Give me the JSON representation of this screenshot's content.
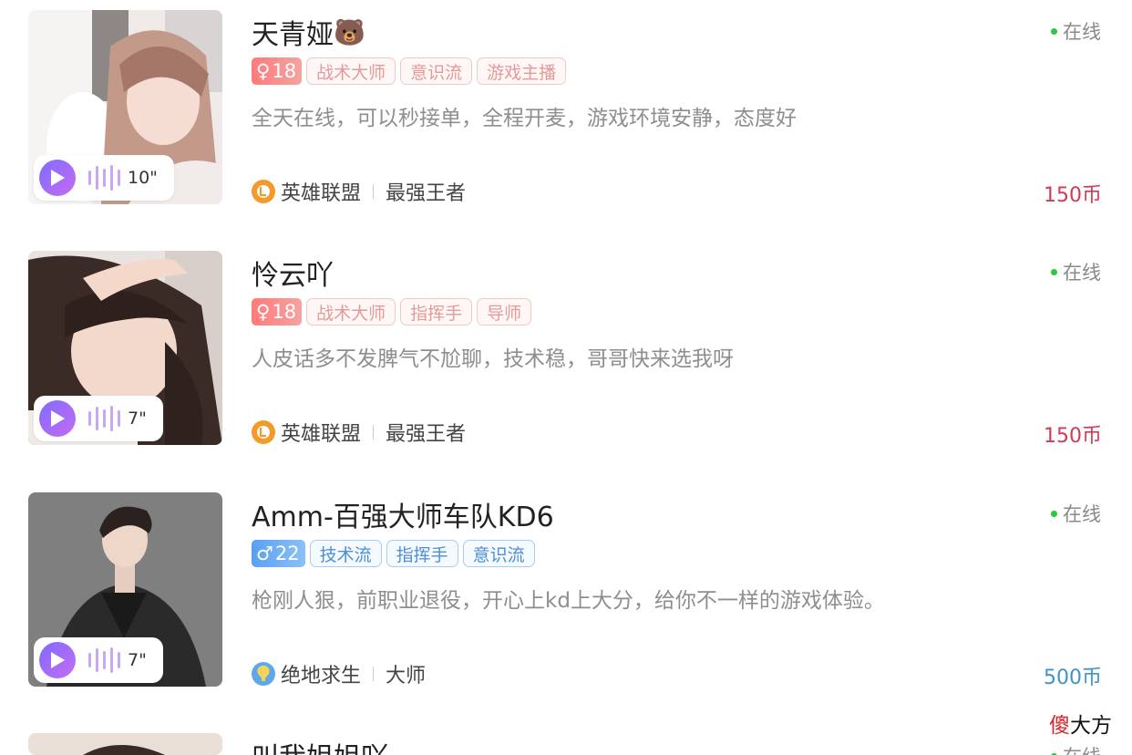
{
  "players": [
    {
      "name": "天青娅",
      "name_emoji": "🐻",
      "status": "在线",
      "gender": "female",
      "gender_symbol": "♀",
      "age": "18",
      "tags": [
        "战术大师",
        "意识流",
        "游戏主播"
      ],
      "description": "全天在线，可以秒接单，全程开麦，游戏环境安静，态度好",
      "voice_duration": "10\"",
      "game_icon": "league-of-legends-icon",
      "game": "英雄联盟",
      "rank": "最强王者",
      "price": "150币",
      "price_color": "#d23a55"
    },
    {
      "name": "怜云吖",
      "status": "在线",
      "gender": "female",
      "gender_symbol": "♀",
      "age": "18",
      "tags": [
        "战术大师",
        "指挥手",
        "导师"
      ],
      "description": "人皮话多不发脾气不尬聊，技术稳，哥哥快来选我呀",
      "voice_duration": "7\"",
      "game_icon": "league-of-legends-icon",
      "game": "英雄联盟",
      "rank": "最强王者",
      "price": "150币",
      "price_color": "#d23a55"
    },
    {
      "name": "Amm-百强大师车队KD6",
      "status": "在线",
      "gender": "male",
      "gender_symbol": "♂",
      "age": "22",
      "tags": [
        "技术流",
        "指挥手",
        "意识流"
      ],
      "description": "枪刚人狠，前职业退役，开心上kd上大分，给你不一样的游戏体验。",
      "voice_duration": "7\"",
      "game_icon": "pubg-icon",
      "game": "绝地求生",
      "rank": "大师",
      "price": "500币",
      "price_color": "#3e94c8"
    },
    {
      "name": "叫我姐姐吖",
      "status": "在线"
    }
  ],
  "watermark": {
    "first": "傻",
    "rest": "大方"
  },
  "colors": {
    "online_dot": "#28c840",
    "female_tag": "#e39a98",
    "male_tag": "#4d8fd6",
    "play_gradient_start": "#7f6bff",
    "play_gradient_end": "#c56df2"
  }
}
